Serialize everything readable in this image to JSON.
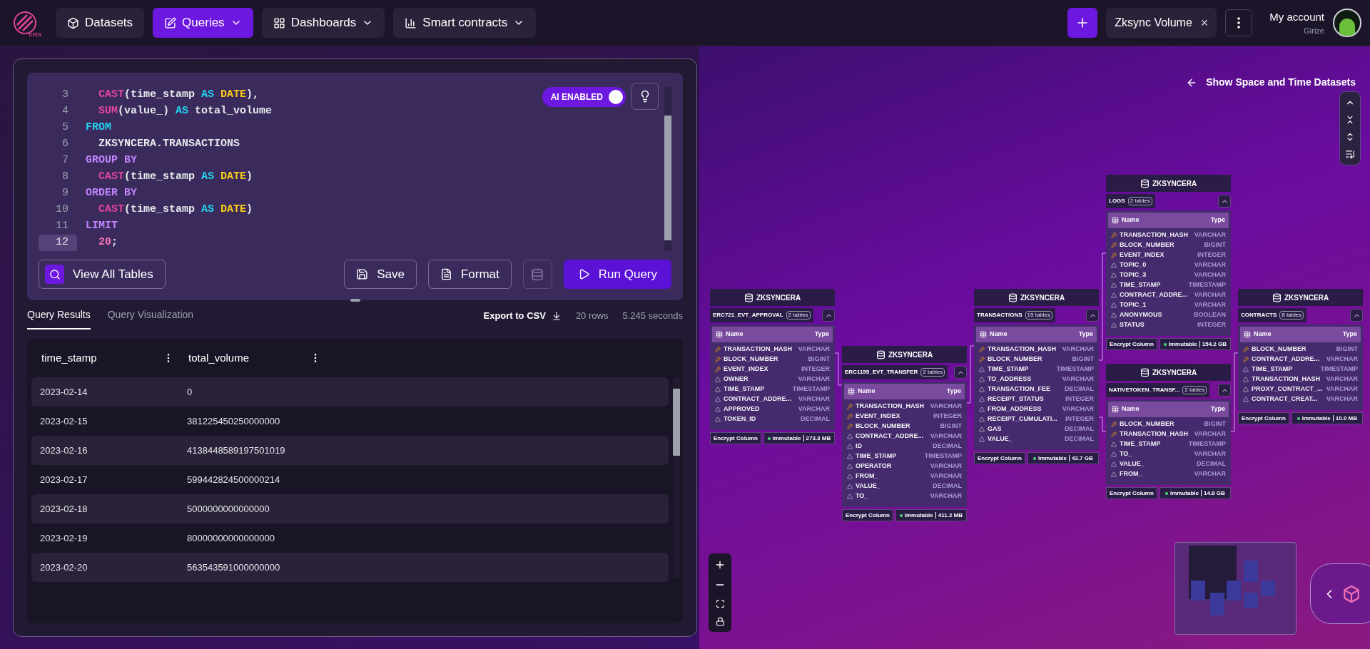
{
  "header": {
    "logo_badge": "beta",
    "nav": [
      {
        "label": "Datasets",
        "selected": false,
        "caret": false
      },
      {
        "label": "Queries",
        "selected": true,
        "caret": true
      },
      {
        "label": "Dashboards",
        "selected": false,
        "caret": true
      },
      {
        "label": "Smart contracts",
        "selected": false,
        "caret": true
      }
    ],
    "open_tab": {
      "label": "Zksync Volume",
      "close": "×"
    },
    "account": {
      "title": "My account",
      "user": "Girize"
    }
  },
  "editor": {
    "ai_toggle": {
      "label": "AI ENABLED",
      "on": true
    },
    "lines": [
      {
        "n": "3",
        "selected": false,
        "tokens": [
          {
            "t": "  CAST",
            "kind": "fn"
          },
          {
            "t": "(time_stamp ",
            "kind": "plain"
          },
          {
            "t": "AS ",
            "kind": "kw"
          },
          {
            "t": "DATE",
            "kind": "type"
          },
          {
            "t": "),",
            "kind": "plain"
          }
        ]
      },
      {
        "n": "4",
        "selected": false,
        "tokens": [
          {
            "t": "  SUM",
            "kind": "fn"
          },
          {
            "t": "(value_) ",
            "kind": "plain"
          },
          {
            "t": "AS ",
            "kind": "kw"
          },
          {
            "t": "total_volume",
            "kind": "plain"
          }
        ]
      },
      {
        "n": "5",
        "selected": false,
        "tokens": [
          {
            "t": "FROM",
            "kind": "kw"
          }
        ]
      },
      {
        "n": "6",
        "selected": false,
        "tokens": [
          {
            "t": "  ZKSYNCERA.TRANSACTIONS",
            "kind": "plain"
          }
        ]
      },
      {
        "n": "7",
        "selected": false,
        "tokens": [
          {
            "t": "GROUP BY",
            "kind": "clause"
          }
        ]
      },
      {
        "n": "8",
        "selected": false,
        "tokens": [
          {
            "t": "  CAST",
            "kind": "fn"
          },
          {
            "t": "(time_stamp ",
            "kind": "plain"
          },
          {
            "t": "AS ",
            "kind": "kw"
          },
          {
            "t": "DATE",
            "kind": "type"
          },
          {
            "t": ")",
            "kind": "plain"
          }
        ]
      },
      {
        "n": "9",
        "selected": false,
        "tokens": [
          {
            "t": "ORDER BY",
            "kind": "clause"
          }
        ]
      },
      {
        "n": "10",
        "selected": false,
        "tokens": [
          {
            "t": "  CAST",
            "kind": "fn"
          },
          {
            "t": "(time_stamp ",
            "kind": "plain"
          },
          {
            "t": "AS ",
            "kind": "kw"
          },
          {
            "t": "DATE",
            "kind": "type"
          },
          {
            "t": ")",
            "kind": "plain"
          }
        ]
      },
      {
        "n": "11",
        "selected": false,
        "tokens": [
          {
            "t": "LIMIT",
            "kind": "clause"
          }
        ]
      },
      {
        "n": "12",
        "selected": true,
        "tokens": [
          {
            "t": "  20",
            "kind": "num"
          },
          {
            "t": ";",
            "kind": "plain"
          }
        ]
      }
    ],
    "view_all": "View All Tables",
    "save": "Save",
    "format": "Format",
    "run": "Run Query"
  },
  "results": {
    "tabs": [
      {
        "label": "Query Results",
        "selected": true
      },
      {
        "label": "Query Visualization",
        "selected": false
      }
    ],
    "export": "Export to CSV",
    "row_count": "20 rows",
    "duration": "5.245 seconds",
    "columns": [
      "time_stamp",
      "total_volume"
    ],
    "rows": [
      [
        "2023-02-14",
        "0"
      ],
      [
        "2023-02-15",
        "381225450250000000"
      ],
      [
        "2023-02-16",
        "4138448589197501019"
      ],
      [
        "2023-02-17",
        "599442824500000214"
      ],
      [
        "2023-02-18",
        "5000000000000000"
      ],
      [
        "2023-02-19",
        "80000000000000000"
      ],
      [
        "2023-02-20",
        "563543591000000000"
      ]
    ]
  },
  "canvas": {
    "show_datasets": "Show Space and Time Datasets",
    "nodes": [
      {
        "db": "ZKSYNCERA",
        "table": "ERC721_EVT_APPROVAL",
        "badge": "2 tables",
        "name_header": "Name",
        "type_header": "Type",
        "encrypt": "Encrypt Column",
        "immutable": "Immutable",
        "size": "273.3 MB",
        "columns": [
          {
            "name": "TRANSACTION_HASH",
            "type": "VARCHAR",
            "kind": "key"
          },
          {
            "name": "BLOCK_NUMBER",
            "type": "BIGINT",
            "kind": "key"
          },
          {
            "name": "EVENT_INDEX",
            "type": "INTEGER",
            "kind": "key"
          },
          {
            "name": "OWNER",
            "type": "VARCHAR",
            "kind": "field"
          },
          {
            "name": "TIME_STAMP",
            "type": "TIMESTAMP",
            "kind": "field"
          },
          {
            "name": "CONTRACT_ADDRE...",
            "type": "VARCHAR",
            "kind": "field"
          },
          {
            "name": "APPROVED",
            "type": "VARCHAR",
            "kind": "field"
          },
          {
            "name": "TOKEN_ID",
            "type": "DECIMAL",
            "kind": "field"
          }
        ]
      },
      {
        "db": "ZKSYNCERA",
        "table": "ERC1155_EVT_TRANSFER",
        "badge": "2 tables",
        "name_header": "Name",
        "type_header": "Type",
        "encrypt": "Encrypt Column",
        "immutable": "Immutable",
        "size": "411.2 MB",
        "columns": [
          {
            "name": "TRANSACTION_HASH",
            "type": "VARCHAR",
            "kind": "key"
          },
          {
            "name": "EVENT_INDEX",
            "type": "INTEGER",
            "kind": "key"
          },
          {
            "name": "BLOCK_NUMBER",
            "type": "BIGINT",
            "kind": "key"
          },
          {
            "name": "CONTRACT_ADDRE...",
            "type": "VARCHAR",
            "kind": "field"
          },
          {
            "name": "ID",
            "type": "DECIMAL",
            "kind": "field"
          },
          {
            "name": "TIME_STAMP",
            "type": "TIMESTAMP",
            "kind": "field"
          },
          {
            "name": "OPERATOR",
            "type": "VARCHAR",
            "kind": "field"
          },
          {
            "name": "FROM_",
            "type": "VARCHAR",
            "kind": "field"
          },
          {
            "name": "VALUE_",
            "type": "DECIMAL",
            "kind": "field"
          },
          {
            "name": "TO_",
            "type": "VARCHAR",
            "kind": "field"
          }
        ]
      },
      {
        "db": "ZKSYNCERA",
        "table": "TRANSACTIONS",
        "badge": "15 tables",
        "name_header": "Name",
        "type_header": "Type",
        "encrypt": "Encrypt Column",
        "immutable": "Immutable",
        "size": "42.7 GB",
        "columns": [
          {
            "name": "TRANSACTION_HASH",
            "type": "VARCHAR",
            "kind": "key"
          },
          {
            "name": "BLOCK_NUMBER",
            "type": "BIGINT",
            "kind": "key"
          },
          {
            "name": "TIME_STAMP",
            "type": "TIMESTAMP",
            "kind": "field"
          },
          {
            "name": "TO_ADDRESS",
            "type": "VARCHAR",
            "kind": "field"
          },
          {
            "name": "TRANSACTION_FEE",
            "type": "DECIMAL",
            "kind": "field"
          },
          {
            "name": "RECEIPT_STATUS",
            "type": "INTEGER",
            "kind": "field"
          },
          {
            "name": "FROM_ADDRESS",
            "type": "VARCHAR",
            "kind": "field"
          },
          {
            "name": "RECEIPT_CUMULATI...",
            "type": "INTEGER",
            "kind": "field"
          },
          {
            "name": "GAS",
            "type": "DECIMAL",
            "kind": "field"
          },
          {
            "name": "VALUE_",
            "type": "DECIMAL",
            "kind": "field"
          }
        ]
      },
      {
        "db": "ZKSYNCERA",
        "table": "LOGS",
        "badge": "2 tables",
        "name_header": "Name",
        "type_header": "Type",
        "encrypt": "Encrypt Column",
        "immutable": "Immutable",
        "size": "154.2 GB",
        "columns": [
          {
            "name": "TRANSACTION_HASH",
            "type": "VARCHAR",
            "kind": "key"
          },
          {
            "name": "BLOCK_NUMBER",
            "type": "BIGINT",
            "kind": "key"
          },
          {
            "name": "EVENT_INDEX",
            "type": "INTEGER",
            "kind": "key"
          },
          {
            "name": "TOPIC_0",
            "type": "VARCHAR",
            "kind": "field"
          },
          {
            "name": "TOPIC_3",
            "type": "VARCHAR",
            "kind": "field"
          },
          {
            "name": "TIME_STAMP",
            "type": "TIMESTAMP",
            "kind": "field"
          },
          {
            "name": "CONTRACT_ADDRE...",
            "type": "VARCHAR",
            "kind": "field"
          },
          {
            "name": "TOPIC_1",
            "type": "VARCHAR",
            "kind": "field"
          },
          {
            "name": "ANONYMOUS",
            "type": "BOOLEAN",
            "kind": "field"
          },
          {
            "name": "STATUS",
            "type": "INTEGER",
            "kind": "field"
          }
        ]
      },
      {
        "db": "ZKSYNCERA",
        "table": "NATIVETOKEN_TRANSF...",
        "badge": "2 tables",
        "name_header": "Name",
        "type_header": "Type",
        "encrypt": "Encrypt Column",
        "immutable": "Immutable",
        "size": "14.8 GB",
        "columns": [
          {
            "name": "BLOCK_NUMBER",
            "type": "BIGINT",
            "kind": "key"
          },
          {
            "name": "TRANSACTION_HASH",
            "type": "VARCHAR",
            "kind": "key"
          },
          {
            "name": "TIME_STAMP",
            "type": "TIMESTAMP",
            "kind": "field"
          },
          {
            "name": "TO_",
            "type": "VARCHAR",
            "kind": "field"
          },
          {
            "name": "VALUE_",
            "type": "DECIMAL",
            "kind": "field"
          },
          {
            "name": "FROM_",
            "type": "VARCHAR",
            "kind": "field"
          }
        ]
      },
      {
        "db": "ZKSYNCERA",
        "table": "CONTRACTS",
        "badge": "8 tables",
        "name_header": "Name",
        "type_header": "Type",
        "encrypt": "Encrypt Column",
        "immutable": "Immutable",
        "size": "10.0 MB",
        "columns": [
          {
            "name": "BLOCK_NUMBER",
            "type": "BIGINT",
            "kind": "key"
          },
          {
            "name": "CONTRACT_ADDRE...",
            "type": "VARCHAR",
            "kind": "key"
          },
          {
            "name": "TIME_STAMP",
            "type": "TIMESTAMP",
            "kind": "field"
          },
          {
            "name": "TRANSACTION_HASH",
            "type": "VARCHAR",
            "kind": "field"
          },
          {
            "name": "PROXY_CONTRACT_...",
            "type": "VARCHAR",
            "kind": "field"
          },
          {
            "name": "CONTRACT_CREAT...",
            "type": "VARCHAR",
            "kind": "field"
          }
        ]
      }
    ]
  }
}
